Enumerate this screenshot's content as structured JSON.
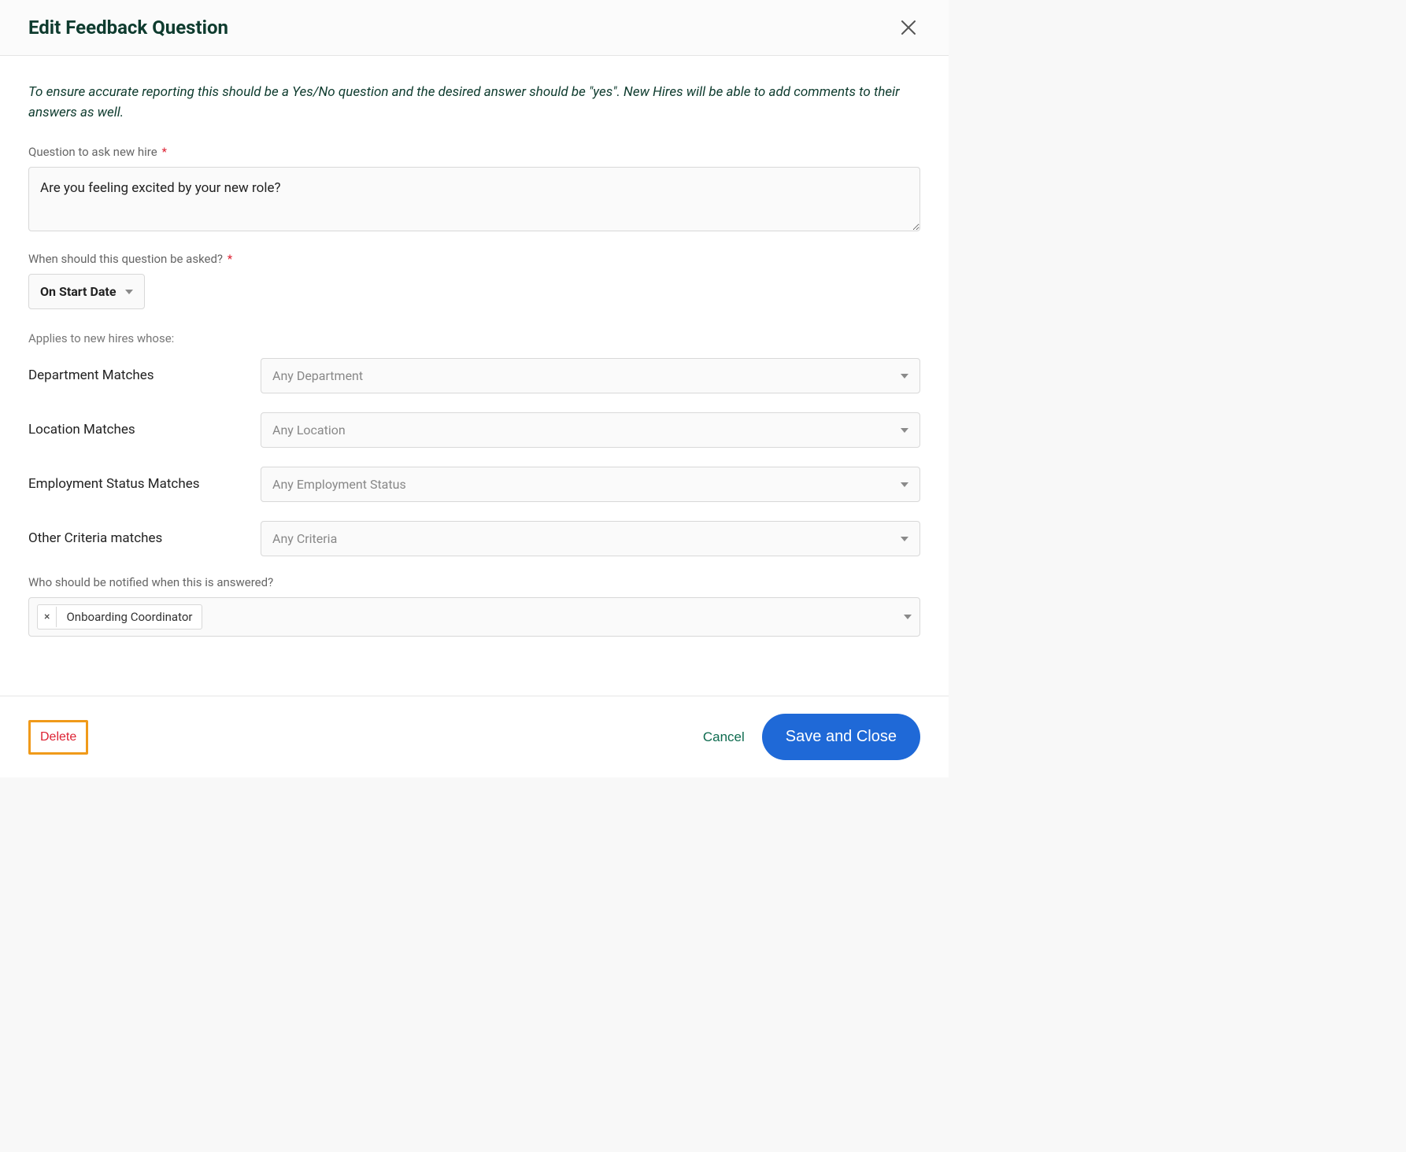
{
  "modal": {
    "title": "Edit Feedback Question",
    "instructions": "To ensure accurate reporting this should be a Yes/No question and the desired answer should be \"yes\". New Hires will be able to add comments to their answers as well."
  },
  "question": {
    "label": "Question to ask new hire",
    "value": "Are you feeling excited by your new role?"
  },
  "when": {
    "label": "When should this question be asked?",
    "selected": "On Start Date"
  },
  "applies_to_label": "Applies to new hires whose:",
  "criteria": {
    "department": {
      "label": "Department Matches",
      "placeholder": "Any Department"
    },
    "location": {
      "label": "Location Matches",
      "placeholder": "Any Location"
    },
    "employment_status": {
      "label": "Employment Status Matches",
      "placeholder": "Any Employment Status"
    },
    "other": {
      "label": "Other Criteria matches",
      "placeholder": "Any Criteria"
    }
  },
  "notify": {
    "label": "Who should be notified when this is answered?",
    "chip": "Onboarding Coordinator"
  },
  "footer": {
    "delete": "Delete",
    "cancel": "Cancel",
    "save": "Save and Close"
  },
  "required_glyph": "*",
  "chip_remove_glyph": "×"
}
